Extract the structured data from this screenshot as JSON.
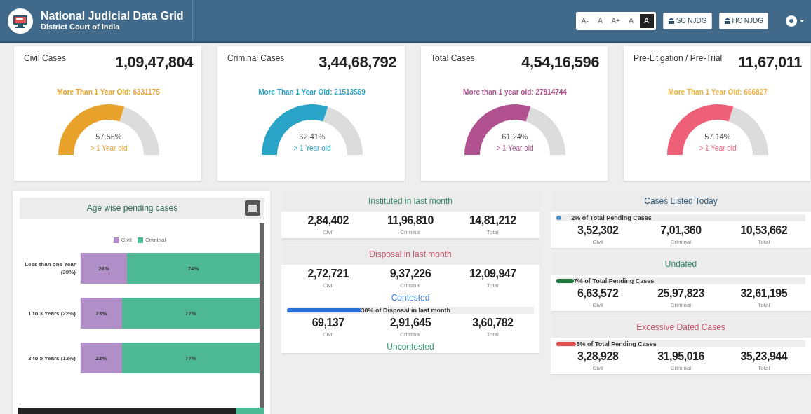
{
  "header": {
    "title": "National Judicial Data Grid",
    "subtitle": "District Court of India",
    "font_buttons": [
      {
        "label": "A-",
        "selected": false
      },
      {
        "label": "A",
        "selected": false
      },
      {
        "label": "A+",
        "selected": false
      },
      {
        "label": "A",
        "selected": false
      },
      {
        "label": "A",
        "selected": true
      }
    ],
    "links": [
      "SC NJDG",
      "HC NJDG"
    ]
  },
  "summary_cards": [
    {
      "title": "Civil Cases",
      "count": "1,09,47,804",
      "note": {
        "text": "More Than 1 Year Old: 6331175",
        "color": "#e8a22c"
      },
      "color": "#e8a22c",
      "percent": "57.56%",
      "caption": "> 1 Year old"
    },
    {
      "title": "Criminal Cases",
      "count": "3,44,68,792",
      "note": {
        "text": "More Than 1 Year Old: 21513569",
        "color": "#2aa3c8"
      },
      "color": "#2aa3c8",
      "percent": "62.41%",
      "caption": "> 1 Year old"
    },
    {
      "title": "Total Cases",
      "count": "4,54,16,596",
      "note": {
        "text": "More than 1 year old: 27814744",
        "color": "#b0508e"
      },
      "color": "#b0508e",
      "percent": "61.24%",
      "caption": "> 1 Year old"
    },
    {
      "title": "Pre-Litigation / Pre-Trial",
      "count": "11,67,011",
      "note": {
        "text": "More Than 1 Year Old: 666827",
        "color": "#f0b040"
      },
      "color": "#ee5f78",
      "percent": "57.14%",
      "caption": "> 1 Year old"
    }
  ],
  "age_chart": {
    "title": "Age wise pending cases",
    "chart_data": {
      "type": "bar",
      "orientation": "horizontal",
      "stacked": true,
      "categories": [
        "Less than one Year (39%)",
        "1 to 3 Years (22%)",
        "3 to 5 Years (13%)"
      ],
      "series": [
        {
          "name": "Civil",
          "color": "#b08fc8",
          "values": [
            26,
            23,
            23
          ],
          "value_labels": [
            "26%",
            "23%",
            "23%"
          ]
        },
        {
          "name": "Criminal",
          "color": "#4cb894",
          "values": [
            74,
            77,
            77
          ],
          "value_labels": [
            "74%",
            "77%",
            "77%"
          ]
        }
      ],
      "data_labels": true,
      "legend": "top"
    }
  },
  "middle_panels": [
    {
      "title": "Instituted in last month",
      "color": "#3a8a6a",
      "items": [
        {
          "kind": "figures",
          "values": [
            {
              "value": "2,84,402",
              "label": "Civil"
            },
            {
              "value": "11,96,810",
              "label": "Criminal"
            },
            {
              "value": "14,81,212",
              "label": "Total"
            }
          ]
        }
      ]
    },
    {
      "title": "Disposal in last month",
      "color": "#c0566b",
      "items": [
        {
          "kind": "figures",
          "values": [
            {
              "value": "2,72,721",
              "label": "Civil"
            },
            {
              "value": "9,37,226",
              "label": "Criminal"
            },
            {
              "value": "12,09,947",
              "label": "Total"
            }
          ]
        },
        {
          "kind": "subheading",
          "text": "Contested",
          "color": "#3b7fd6"
        },
        {
          "kind": "progress",
          "level": 0.3,
          "text": "30% of Disposal in last month",
          "color": "#2a6fd6"
        },
        {
          "kind": "figures",
          "values": [
            {
              "value": "69,137",
              "label": "Civil"
            },
            {
              "value": "2,91,645",
              "label": "Criminal"
            },
            {
              "value": "3,60,782",
              "label": "Total"
            }
          ]
        },
        {
          "kind": "subheading",
          "text": "Uncontested",
          "color": "#3a9a70"
        }
      ]
    }
  ],
  "right_panels": [
    {
      "title": "Cases Listed Today",
      "color": "#2f5a7a",
      "items": [
        {
          "kind": "progress",
          "level": 0.02,
          "text": "2% of Total Pending Cases",
          "color": "#4a90d0"
        },
        {
          "kind": "figures",
          "values": [
            {
              "value": "3,52,302",
              "label": "Civil"
            },
            {
              "value": "7,01,360",
              "label": "Criminal"
            },
            {
              "value": "10,53,662",
              "label": "Total"
            }
          ]
        }
      ]
    },
    {
      "title": "Undated",
      "color": "#2e8a68",
      "items": [
        {
          "kind": "progress",
          "level": 0.07,
          "text": "7% of Total Pending Cases",
          "color": "#1e7a3e"
        },
        {
          "kind": "figures",
          "values": [
            {
              "value": "6,63,572",
              "label": "Civil"
            },
            {
              "value": "25,97,823",
              "label": "Criminal"
            },
            {
              "value": "32,61,195",
              "label": "Total"
            }
          ]
        }
      ]
    },
    {
      "title": "Excessive Dated Cases",
      "color": "#c0566b",
      "items": [
        {
          "kind": "progress",
          "level": 0.08,
          "text": "8% of Total Pending Cases",
          "color": "#e05050"
        },
        {
          "kind": "figures",
          "values": [
            {
              "value": "3,28,928",
              "label": "Civil"
            },
            {
              "value": "31,95,016",
              "label": "Criminal"
            },
            {
              "value": "35,23,944",
              "label": "Total"
            }
          ]
        }
      ]
    }
  ]
}
